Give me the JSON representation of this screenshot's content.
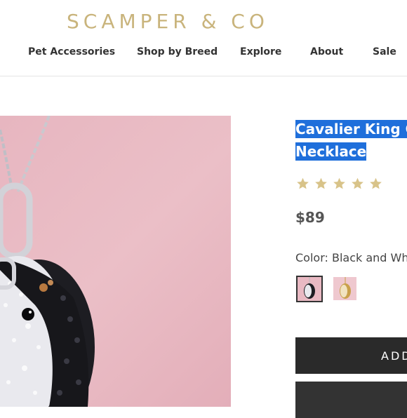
{
  "header": {
    "brand": "SCAMPER & CO",
    "nav": [
      "Pet Accessories",
      "Shop by Breed",
      "Explore",
      "About",
      "Sale"
    ]
  },
  "product": {
    "title_line1": "Cavalier King C",
    "title_line2": "Necklace",
    "rating": 5,
    "rating_max": 5,
    "price": "$89",
    "color_label": "Color: Black and Wh",
    "add_button_label": "ADD"
  },
  "colors": {
    "brand_gold": "#c9b47c",
    "star_gold": "#d8c389",
    "selection_blue": "#1f6fdb",
    "button_dark": "#2a2a2a"
  }
}
